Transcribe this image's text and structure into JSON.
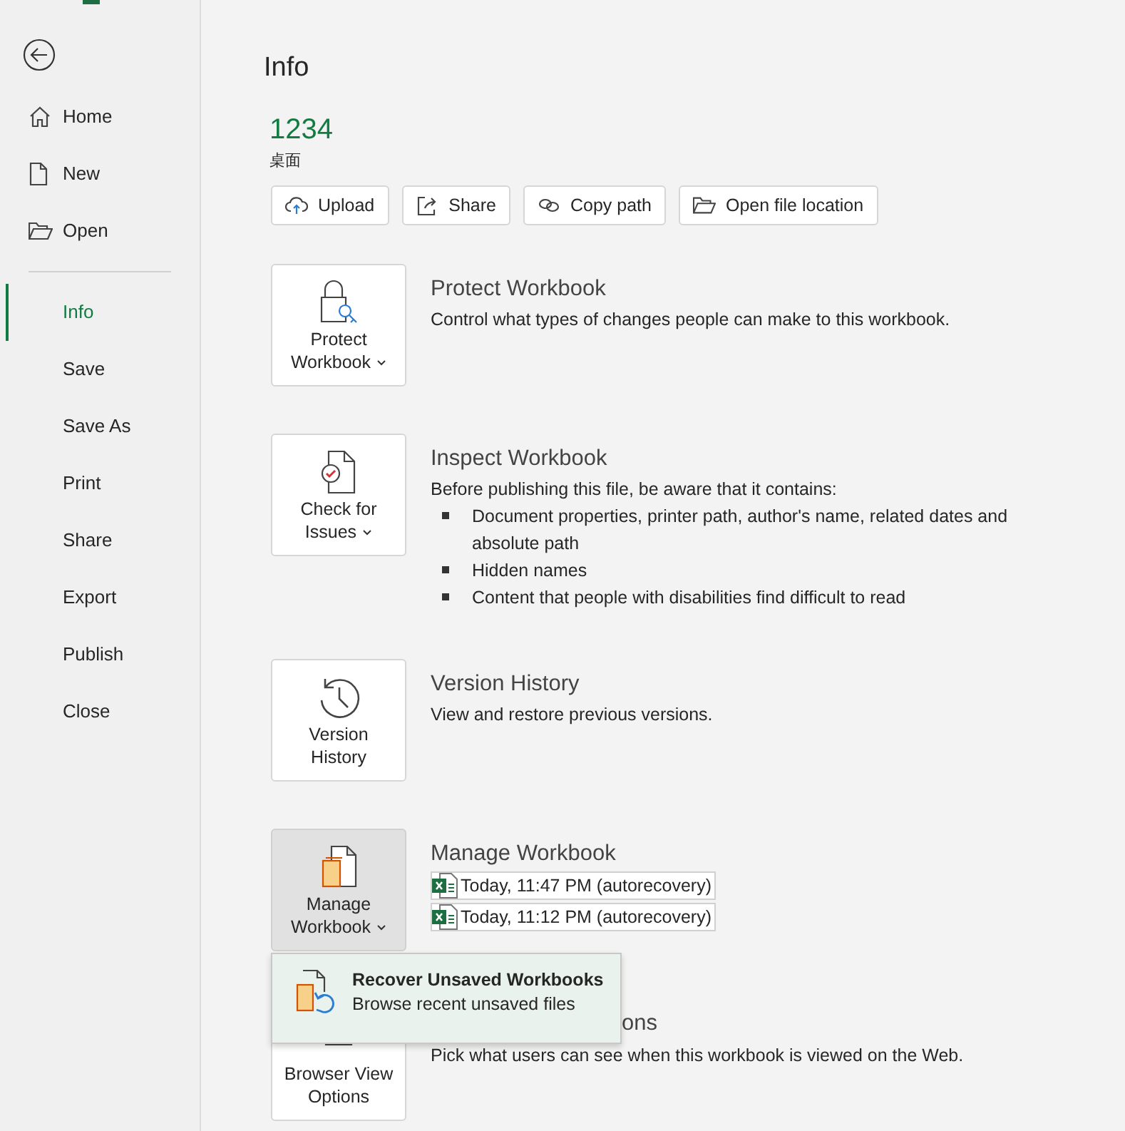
{
  "sidebar": {
    "top_items": [
      {
        "label": "Home",
        "selected": false
      },
      {
        "label": "New",
        "selected": false
      },
      {
        "label": "Open",
        "selected": false
      }
    ],
    "items": [
      {
        "label": "Info",
        "selected": true
      },
      {
        "label": "Save",
        "selected": false
      },
      {
        "label": "Save As",
        "selected": false
      },
      {
        "label": "Print",
        "selected": false
      },
      {
        "label": "Share",
        "selected": false
      },
      {
        "label": "Export",
        "selected": false
      },
      {
        "label": "Publish",
        "selected": false
      },
      {
        "label": "Close",
        "selected": false
      }
    ]
  },
  "page_title": "Info",
  "file": {
    "name": "1234",
    "location": "桌面"
  },
  "actions": [
    {
      "label": "Upload"
    },
    {
      "label": "Share"
    },
    {
      "label": "Copy path"
    },
    {
      "label": "Open file location"
    }
  ],
  "sections": [
    {
      "kind": "protect",
      "tile": {
        "lines": [
          "Protect",
          "Workbook"
        ],
        "has_menu": true,
        "selected": false
      },
      "title": "Protect Workbook",
      "description": "Control what types of changes people can make to this workbook."
    },
    {
      "kind": "inspect",
      "tile": {
        "lines": [
          "Check for",
          "Issues"
        ],
        "has_menu": true,
        "selected": false
      },
      "title": "Inspect Workbook",
      "description": "Before publishing this file, be aware that it contains:",
      "bullets": [
        "Document properties, printer path, author's name, related dates and absolute path",
        "Hidden names",
        "Content that people with disabilities find difficult to read"
      ]
    },
    {
      "kind": "history",
      "tile": {
        "lines": [
          "Version",
          "History"
        ],
        "has_menu": false,
        "selected": false
      },
      "title": "Version History",
      "description": "View and restore previous versions."
    },
    {
      "kind": "manage",
      "tile": {
        "lines": [
          "Manage",
          "Workbook"
        ],
        "has_menu": true,
        "selected": true
      },
      "title": "Manage Workbook",
      "versions": [
        "Today, 11:47 PM (autorecovery)",
        "Today, 11:12 PM (autorecovery)"
      ],
      "menu": {
        "title": "Recover Unsaved Workbooks",
        "subtitle": "Browse recent unsaved files"
      }
    },
    {
      "kind": "browser",
      "tile": {
        "lines": [
          "Browser View",
          "Options"
        ],
        "has_menu": false,
        "selected": false
      },
      "title": "ons",
      "description": "Pick what users can see when this workbook is viewed on the Web."
    }
  ]
}
